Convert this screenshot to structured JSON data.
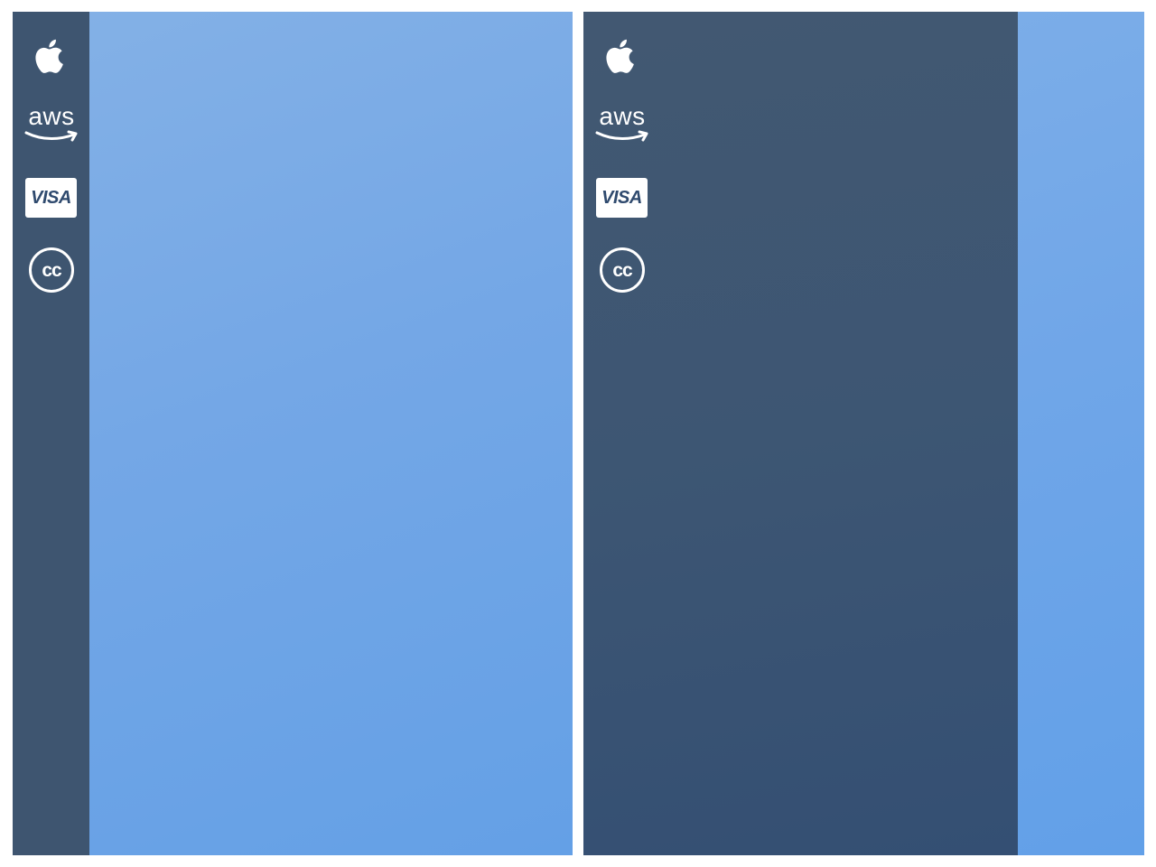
{
  "panels": [
    {
      "id": "left",
      "sidebar_state": "collapsed",
      "icons": [
        {
          "name": "apple-icon"
        },
        {
          "name": "aws-icon",
          "text": "aws"
        },
        {
          "name": "visa-icon",
          "text": "VISA"
        },
        {
          "name": "creative-commons-icon",
          "text": "cc"
        }
      ]
    },
    {
      "id": "right",
      "sidebar_state": "expanded",
      "icons": [
        {
          "name": "apple-icon"
        },
        {
          "name": "aws-icon",
          "text": "aws"
        },
        {
          "name": "visa-icon",
          "text": "VISA"
        },
        {
          "name": "creative-commons-icon",
          "text": "cc"
        }
      ]
    }
  ],
  "colors": {
    "sidebar": "#3e5570",
    "content_gradient_start": "#84b1e6",
    "content_gradient_end": "#64a0e6",
    "icon": "#ffffff",
    "visa_text": "#2f4a6e"
  }
}
